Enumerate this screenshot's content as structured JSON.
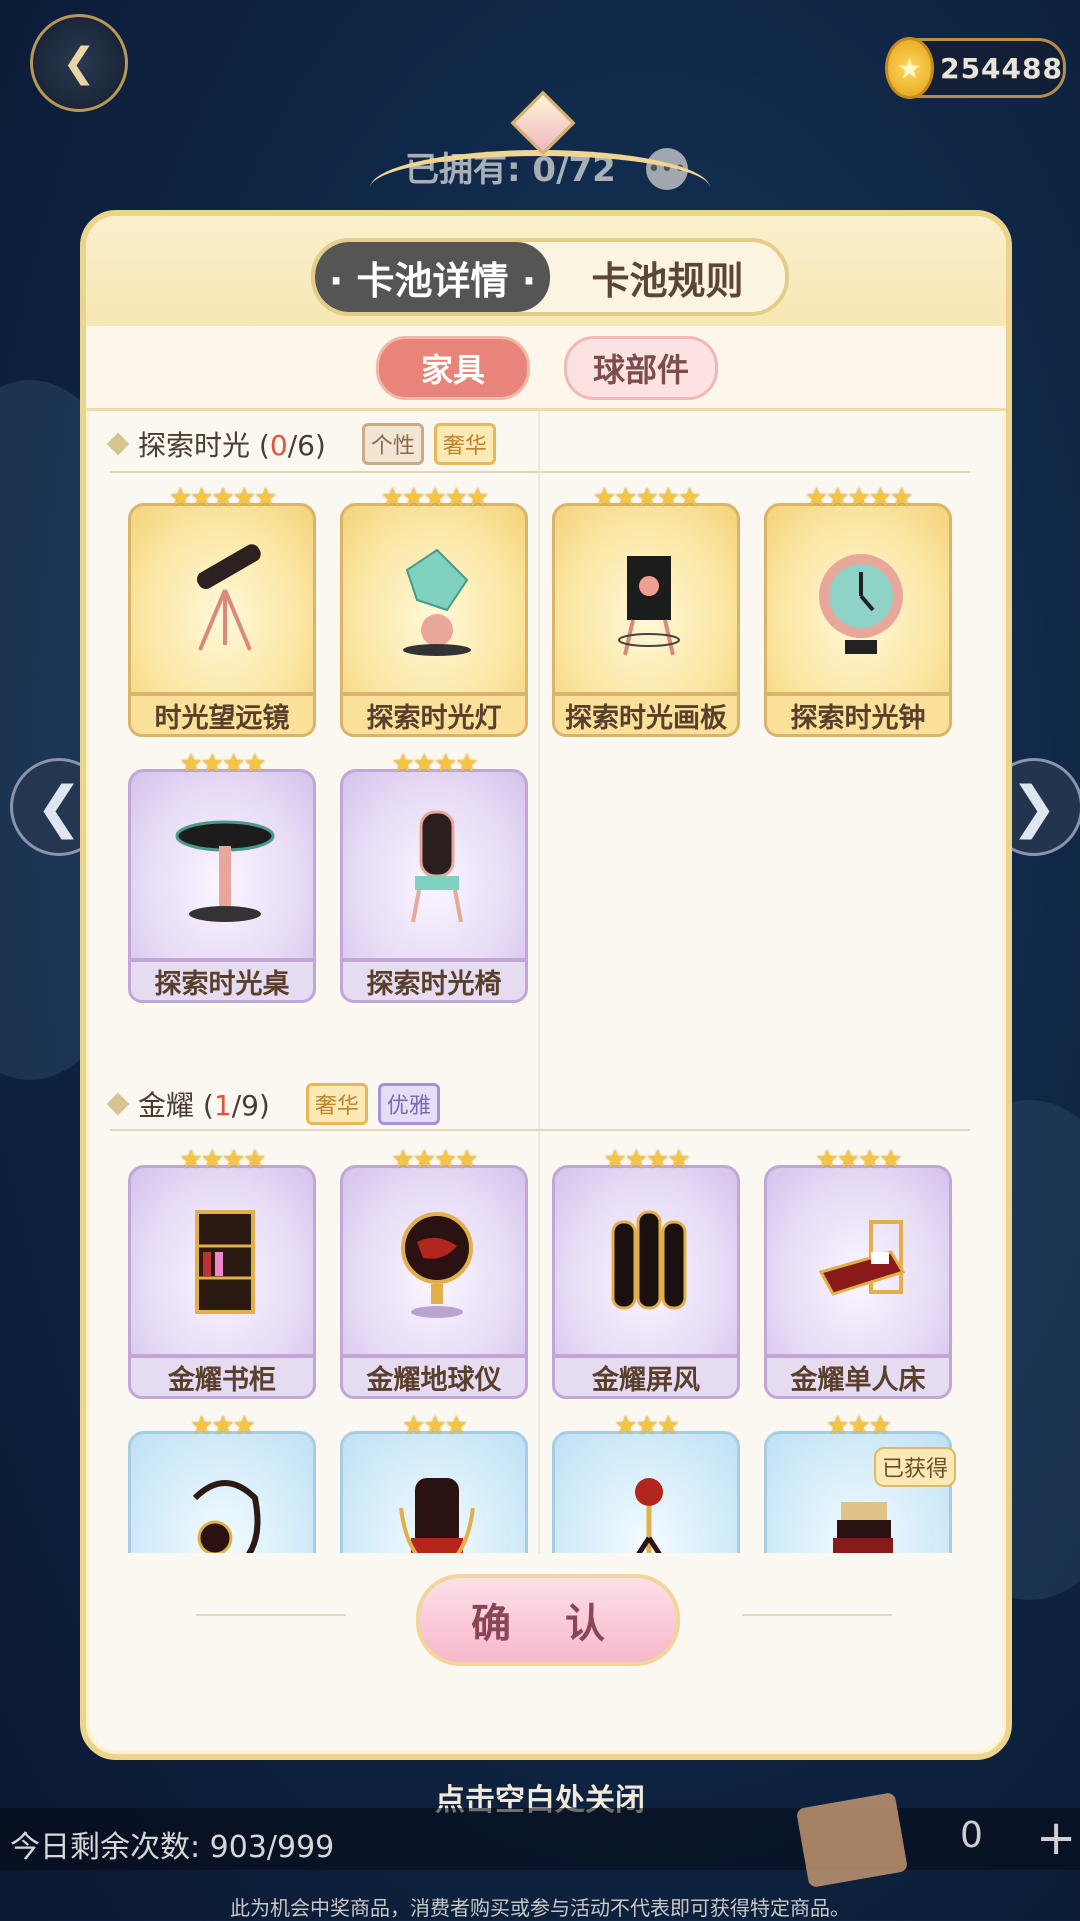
{
  "header": {
    "back_icon": "back-arrow-icon",
    "coins": "254488",
    "owned_text": "已拥有: 0/72"
  },
  "panel": {
    "tabs": [
      {
        "label": "· 卡池详情 ·",
        "active": true
      },
      {
        "label": "卡池规则",
        "active": false
      }
    ],
    "sub_tabs": [
      {
        "label": "家具",
        "active": true
      },
      {
        "label": "球部件",
        "active": false
      }
    ],
    "sections": [
      {
        "title": "探索时光",
        "count_open": "(",
        "count_owned": "0",
        "count_total": "/6)",
        "tags": [
          "个性",
          "奢华"
        ],
        "items": [
          {
            "name": "时光望远镜",
            "stars": "★★★★★"
          },
          {
            "name": "探索时光灯",
            "stars": "★★★★★"
          },
          {
            "name": "探索时光画板",
            "stars": "★★★★★"
          },
          {
            "name": "探索时光钟",
            "stars": "★★★★★"
          },
          {
            "name": "探索时光桌",
            "stars": "★★★★"
          },
          {
            "name": "探索时光椅",
            "stars": "★★★★"
          }
        ]
      },
      {
        "title": "金耀",
        "count_open": "(",
        "count_owned": "1",
        "count_total": "/9)",
        "tags": [
          "奢华",
          "优雅"
        ],
        "items": [
          {
            "name": "金耀书柜",
            "stars": "★★★★"
          },
          {
            "name": "金耀地球仪",
            "stars": "★★★★"
          },
          {
            "name": "金耀屏风",
            "stars": "★★★★"
          },
          {
            "name": "金耀单人床",
            "stars": "★★★★"
          },
          {
            "name": "",
            "stars": "★★★"
          },
          {
            "name": "",
            "stars": "★★★"
          },
          {
            "name": "",
            "stars": "★★★"
          },
          {
            "name": "",
            "stars": "★★★",
            "badge": "已获得"
          }
        ]
      }
    ],
    "confirm_label": "确 认"
  },
  "close_hint": "点击空白处关闭",
  "footer": {
    "remaining": "今日剩余次数: 903/999",
    "ticket_count": "0",
    "plus": "+",
    "disclaimer": "此为机会中奖商品，消费者购买或参与活动不代表即可获得特定商品。"
  },
  "colors": {
    "accent_gold": "#ecd48c",
    "active_pill": "#e8847a",
    "count_red": "#e2533f"
  }
}
